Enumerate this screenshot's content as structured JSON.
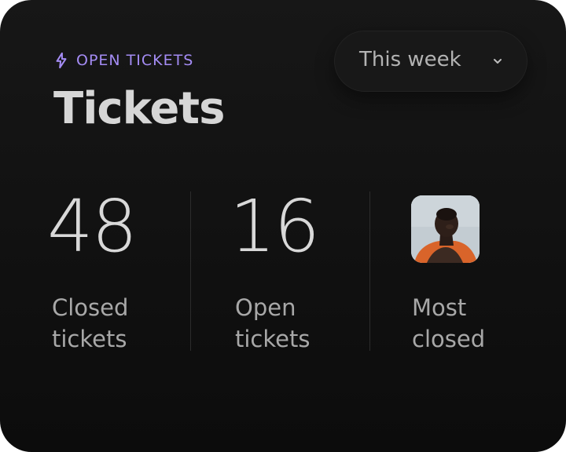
{
  "card": {
    "eyebrow": "OPEN TICKETS",
    "eyebrow_icon": "sparkle-icon",
    "title": "Tickets",
    "accent_color": "#a48cf4"
  },
  "filter": {
    "selected": "This week",
    "icon": "chevron-down-icon"
  },
  "stats": [
    {
      "value": "48",
      "label_line1": "Closed",
      "label_line2": "tickets"
    },
    {
      "value": "16",
      "label_line1": "Open",
      "label_line2": "tickets"
    },
    {
      "label_line1": "Most",
      "label_line2": "closed",
      "avatar": "avatar-photo"
    }
  ]
}
